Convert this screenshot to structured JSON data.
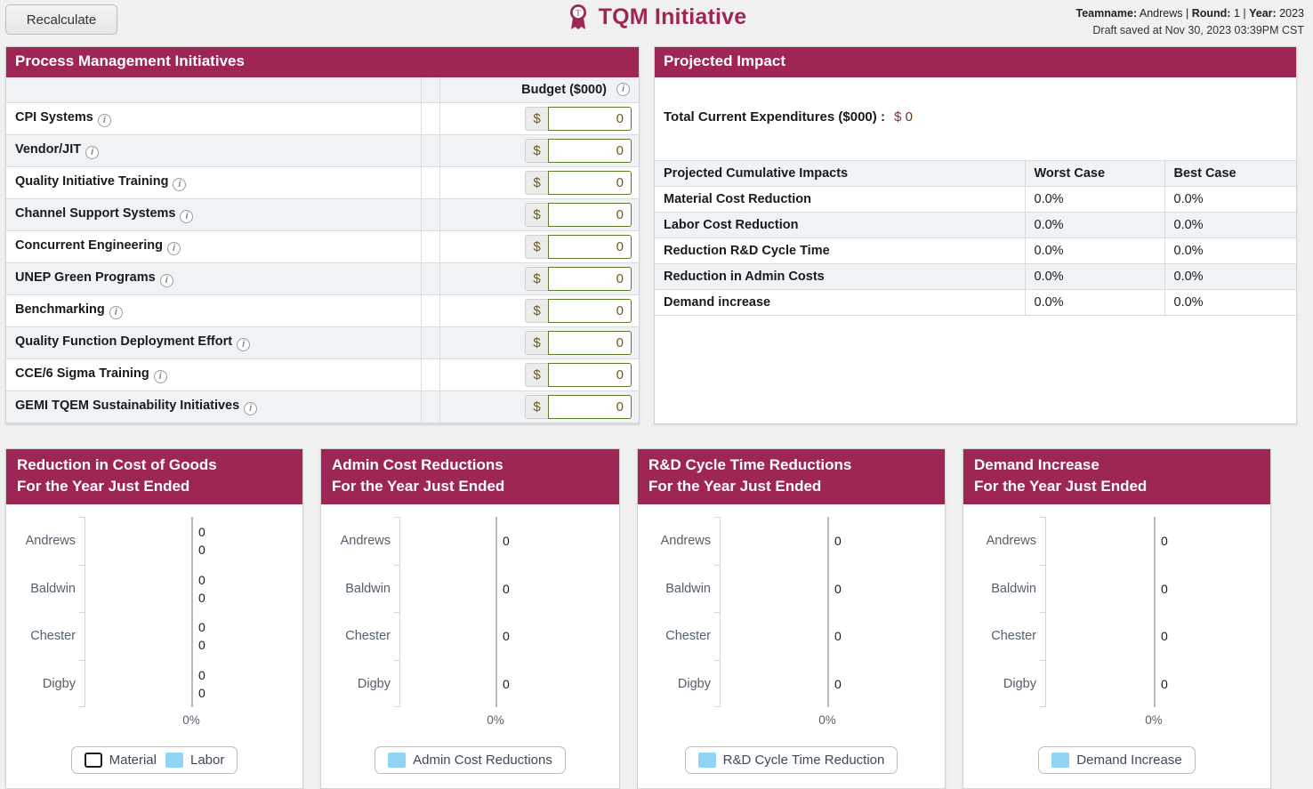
{
  "header": {
    "recalculate_label": "Recalculate",
    "title": "TQM Initiative",
    "logo_icon": "award-ribbon-icon",
    "teamname_label": "Teamname:",
    "teamname_value": "Andrews",
    "sep1": "|",
    "round_label": "Round:",
    "round_value": "1",
    "sep2": "|",
    "year_label": "Year:",
    "year_value": "2023",
    "draft_saved": "Draft saved at Nov 30, 2023 03:39PM CST"
  },
  "process_panel": {
    "title": "Process Management Initiatives",
    "budget_header": "Budget ($000)",
    "info_icon": "info-icon",
    "currency_symbol": "$",
    "rows": [
      {
        "label": "CPI Systems",
        "value": "0"
      },
      {
        "label": "Vendor/JIT",
        "value": "0"
      },
      {
        "label": "Quality Initiative Training",
        "value": "0"
      },
      {
        "label": "Channel Support Systems",
        "value": "0"
      },
      {
        "label": "Concurrent Engineering",
        "value": "0"
      },
      {
        "label": "UNEP Green Programs",
        "value": "0"
      },
      {
        "label": "Benchmarking",
        "value": "0"
      },
      {
        "label": "Quality Function Deployment Effort",
        "value": "0"
      },
      {
        "label": "CCE/6 Sigma Training",
        "value": "0"
      },
      {
        "label": "GEMI TQEM Sustainability Initiatives",
        "value": "0"
      }
    ]
  },
  "projected_impact": {
    "title": "Projected Impact",
    "total_label": "Total Current Expenditures ($000) :",
    "total_currency": "$",
    "total_value": "0",
    "columns": [
      "Projected Cumulative Impacts",
      "Worst Case",
      "Best Case"
    ],
    "rows": [
      {
        "label": "Material Cost Reduction",
        "worst": "0.0%",
        "best": "0.0%"
      },
      {
        "label": "Labor Cost Reduction",
        "worst": "0.0%",
        "best": "0.0%"
      },
      {
        "label": "Reduction R&D Cycle Time",
        "worst": "0.0%",
        "best": "0.0%"
      },
      {
        "label": "Reduction in Admin Costs",
        "worst": "0.0%",
        "best": "0.0%"
      },
      {
        "label": "Demand increase",
        "worst": "0.0%",
        "best": "0.0%"
      }
    ]
  },
  "colors": {
    "brand_maroon": "#9e2655",
    "legend_blue": "#8fd4f5",
    "alt_row": "#eff3f6",
    "input_border": "#5b7a2e",
    "page_bg": "#f2f2f2"
  },
  "chart_data": [
    {
      "type": "bar",
      "orientation": "horizontal",
      "title": "Reduction in Cost of Goods",
      "subtitle": "For the Year Just Ended",
      "categories": [
        "Andrews",
        "Baldwin",
        "Chester",
        "Digby"
      ],
      "series": [
        {
          "name": "Material",
          "values": [
            0,
            0,
            0,
            0
          ],
          "color": "#ffffff"
        },
        {
          "name": "Labor",
          "values": [
            0,
            0,
            0,
            0
          ],
          "color": "#8fd4f5"
        }
      ],
      "data_labels": [
        [
          "0",
          "0"
        ],
        [
          "0",
          "0"
        ],
        [
          "0",
          "0"
        ],
        [
          "0",
          "0"
        ]
      ],
      "xlabel": "",
      "ylabel": "",
      "xticks": [
        "0%"
      ],
      "xlim": [
        0,
        0
      ],
      "grid": false,
      "legend_position": "bottom"
    },
    {
      "type": "bar",
      "orientation": "horizontal",
      "title": "Admin Cost Reductions",
      "subtitle": "For the Year Just Ended",
      "categories": [
        "Andrews",
        "Baldwin",
        "Chester",
        "Digby"
      ],
      "series": [
        {
          "name": "Admin Cost Reductions",
          "values": [
            0,
            0,
            0,
            0
          ],
          "color": "#8fd4f5"
        }
      ],
      "data_labels": [
        [
          "0"
        ],
        [
          "0"
        ],
        [
          "0"
        ],
        [
          "0"
        ]
      ],
      "xlabel": "",
      "ylabel": "",
      "xticks": [
        "0%"
      ],
      "xlim": [
        0,
        0
      ],
      "grid": false,
      "legend_position": "bottom"
    },
    {
      "type": "bar",
      "orientation": "horizontal",
      "title": "R&D Cycle Time Reductions",
      "subtitle": "For the Year Just Ended",
      "categories": [
        "Andrews",
        "Baldwin",
        "Chester",
        "Digby"
      ],
      "series": [
        {
          "name": "R&D Cycle Time Reduction",
          "values": [
            0,
            0,
            0,
            0
          ],
          "color": "#8fd4f5"
        }
      ],
      "data_labels": [
        [
          "0"
        ],
        [
          "0"
        ],
        [
          "0"
        ],
        [
          "0"
        ]
      ],
      "xlabel": "",
      "ylabel": "",
      "xticks": [
        "0%"
      ],
      "xlim": [
        0,
        0
      ],
      "grid": false,
      "legend_position": "bottom"
    },
    {
      "type": "bar",
      "orientation": "horizontal",
      "title": "Demand Increase",
      "subtitle": "For the Year Just Ended",
      "categories": [
        "Andrews",
        "Baldwin",
        "Chester",
        "Digby"
      ],
      "series": [
        {
          "name": "Demand Increase",
          "values": [
            0,
            0,
            0,
            0
          ],
          "color": "#8fd4f5"
        }
      ],
      "data_labels": [
        [
          "0"
        ],
        [
          "0"
        ],
        [
          "0"
        ],
        [
          "0"
        ]
      ],
      "xlabel": "",
      "ylabel": "",
      "xticks": [
        "0%"
      ],
      "xlim": [
        0,
        0
      ],
      "grid": false,
      "legend_position": "bottom"
    }
  ]
}
